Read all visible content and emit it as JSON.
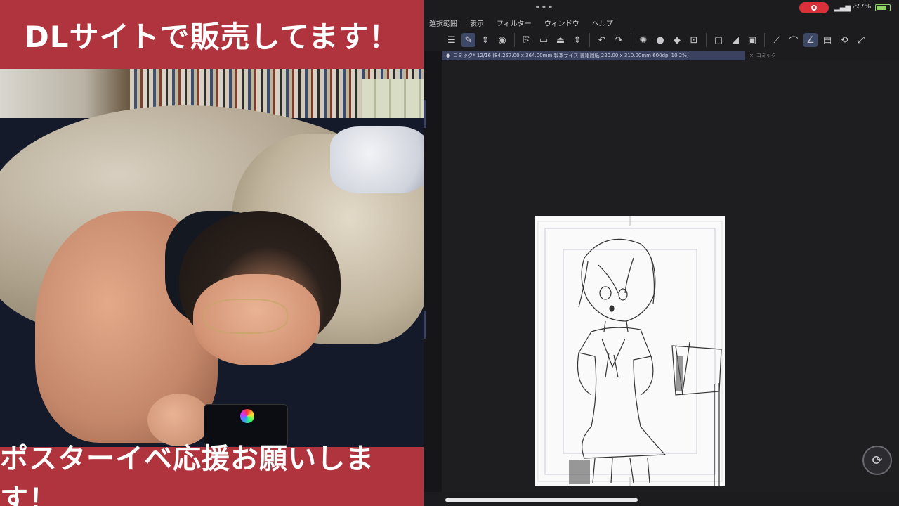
{
  "overlay": {
    "top_banner": "DLサイトで販売してます！",
    "bottom_banner": "ポスターイベ応援お願いします！",
    "banner_color": "#b0343d"
  },
  "status_bar": {
    "battery_percent": "77%",
    "recording": true,
    "battery_color": "#8fd46a",
    "record_color": "#d9303a"
  },
  "menu": {
    "items": [
      "選択範囲",
      "表示",
      "フィルター",
      "ウィンドウ",
      "ヘルプ"
    ]
  },
  "toolbar": {
    "icons": [
      "menu-icon",
      "pen-icon",
      "chevron-icon",
      "layer-icon",
      "new-file-icon",
      "open-folder-icon",
      "save-icon",
      "chevron-icon",
      "undo-icon",
      "redo-icon",
      "settings-icon",
      "circle-icon",
      "fill-icon",
      "transform-icon",
      "select-icon",
      "crop-icon",
      "mask-icon",
      "ruler-icon",
      "brush-icon",
      "active-pen-icon",
      "clipboard-icon",
      "rotate-icon",
      "expand-icon"
    ]
  },
  "tabs": {
    "active": "コミック* 12/16 (84.257.00 x 364.00mm 製本サイズ 書籍用紙 220.00 x 310.00mm 600dpi 10.2%)",
    "inactive": "コミック"
  },
  "accent_color": "#3a4260"
}
